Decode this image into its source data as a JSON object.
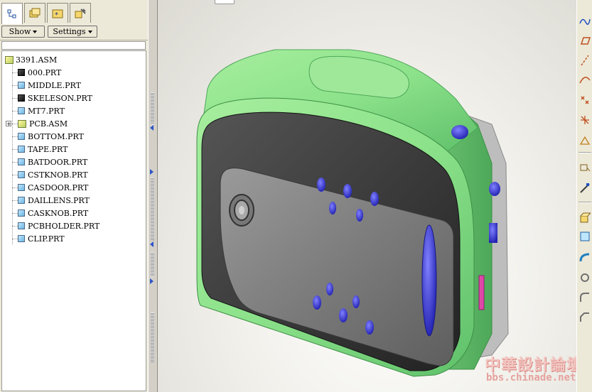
{
  "navigator": {
    "tabs": [
      {
        "name": "model-tree",
        "icon": "model-tree-icon"
      },
      {
        "name": "folder-browser",
        "icon": "folder-browser-icon"
      },
      {
        "name": "favorites",
        "icon": "favorites-icon"
      },
      {
        "name": "connections",
        "icon": "connections-icon"
      }
    ],
    "show_label": "Show",
    "settings_label": "Settings"
  },
  "model_tree": {
    "root": "3391.ASM",
    "items": [
      {
        "label": "000.PRT",
        "type": "part-dark"
      },
      {
        "label": "MIDDLE.PRT",
        "type": "part"
      },
      {
        "label": "SKELESON.PRT",
        "type": "part-dark"
      },
      {
        "label": "MT7.PRT",
        "type": "part"
      },
      {
        "label": "PCB.ASM",
        "type": "assembly",
        "expandable": true
      },
      {
        "label": "BOTTOM.PRT",
        "type": "part"
      },
      {
        "label": "TAPE.PRT",
        "type": "part"
      },
      {
        "label": "BATDOOR.PRT",
        "type": "part"
      },
      {
        "label": "CSTKNOB.PRT",
        "type": "part"
      },
      {
        "label": "CASDOOR.PRT",
        "type": "part"
      },
      {
        "label": "DAILLENS.PRT",
        "type": "part"
      },
      {
        "label": "CASKNOB.PRT",
        "type": "part"
      },
      {
        "label": "PCBHOLDER.PRT",
        "type": "part"
      },
      {
        "label": "CLIP.PRT",
        "type": "part"
      }
    ],
    "expand_symbol": "+"
  },
  "watermark": {
    "chinese": "中華設計論壇",
    "url": "bbs.chinade.net"
  },
  "right_toolbar": {
    "tools": [
      "sketch-icon",
      "plane-icon",
      "axis-icon",
      "curve-icon",
      "point-icon",
      "csys-icon",
      "analysis-icon",
      "annotation-icon",
      "mirror-icon",
      "extrude-icon",
      "revolve-icon",
      "sweep-icon",
      "hole-icon",
      "round-icon",
      "chamfer-icon"
    ]
  },
  "colors": {
    "body_green": "#8fe08c",
    "panel_dark": "#3a3a3a",
    "plate_gray": "#7a7a7a",
    "buttons_blue": "#4040d8",
    "accent_magenta": "#e040a0"
  }
}
